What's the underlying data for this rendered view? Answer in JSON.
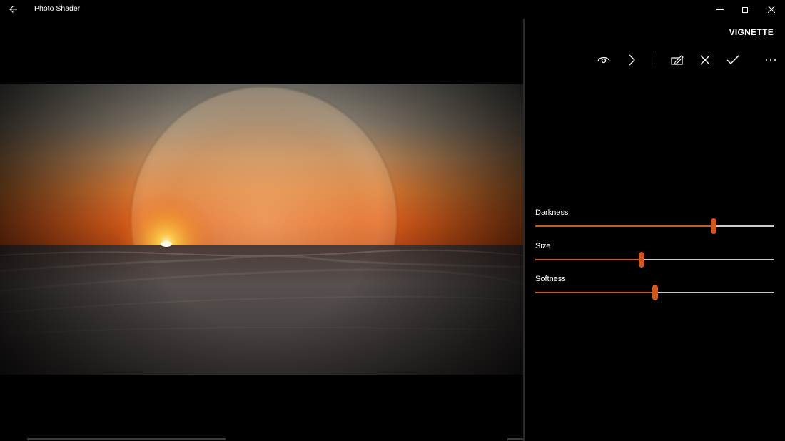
{
  "window": {
    "title": "Photo Shader",
    "back_icon": "back-arrow-icon",
    "controls": [
      "minimize-icon",
      "restore-icon",
      "close-icon"
    ]
  },
  "panel": {
    "title": "VIGNETTE",
    "toolbar": [
      "eye-icon",
      "chevron-right-icon",
      "edit-icon",
      "cancel-x-icon",
      "check-icon",
      "more-icon"
    ]
  },
  "sliders": [
    {
      "label": "Darkness",
      "value": 0.745
    },
    {
      "label": "Size",
      "value": 0.445
    },
    {
      "label": "Softness",
      "value": 0.5
    }
  ],
  "colors": {
    "accent": "#d2571c",
    "track": "#cccccc",
    "background": "#000000"
  }
}
